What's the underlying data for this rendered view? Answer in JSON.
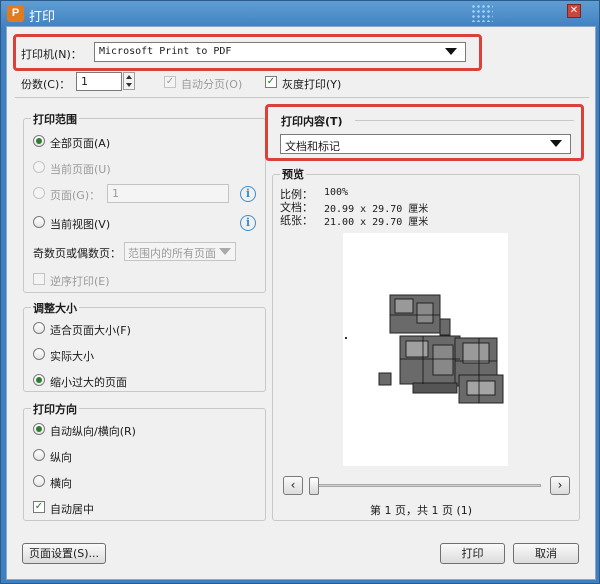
{
  "window": {
    "title": "打印",
    "app_icon": "P"
  },
  "printer": {
    "label": "打印机(N)：",
    "value": "Microsoft Print to PDF"
  },
  "copies": {
    "label": "份数(C)：",
    "value": "1"
  },
  "options": {
    "collate_label": "自动分页(O)",
    "grayscale_label": "灰度打印(Y)"
  },
  "print_range": {
    "title": "打印范围",
    "all_pages": "全部页面(A)",
    "current_page": "当前页面(U)",
    "pages": "页面(G)：",
    "pages_value": "1",
    "current_view": "当前视图(V)",
    "odd_even_label": "奇数页或偶数页：",
    "odd_even_value": "范围内的所有页面",
    "reverse": "逆序打印(E)"
  },
  "scale": {
    "title": "调整大小",
    "fit": "适合页面大小(F)",
    "actual": "实际大小",
    "shrink": "缩小过大的页面"
  },
  "orientation": {
    "title": "打印方向",
    "auto": "自动纵向/横向(R)",
    "portrait": "纵向",
    "landscape": "横向",
    "center": "自动居中"
  },
  "content": {
    "title": "打印内容(T)",
    "value": "文档和标记"
  },
  "preview": {
    "title": "预览",
    "ratio_label": "比例：",
    "ratio_value": "100%",
    "doc_label": "文档：",
    "doc_value": "20.99 x 29.70 厘米",
    "paper_label": "纸张：",
    "paper_value": "21.00 x 29.70 厘米",
    "page_status": "第 1 页，共 1 页 (1)"
  },
  "buttons": {
    "page_setup": "页面设置(S)...",
    "print": "打印",
    "cancel": "取消"
  },
  "colors": {
    "highlight": "#d9413a",
    "title_bar": "#3f7fc0"
  }
}
